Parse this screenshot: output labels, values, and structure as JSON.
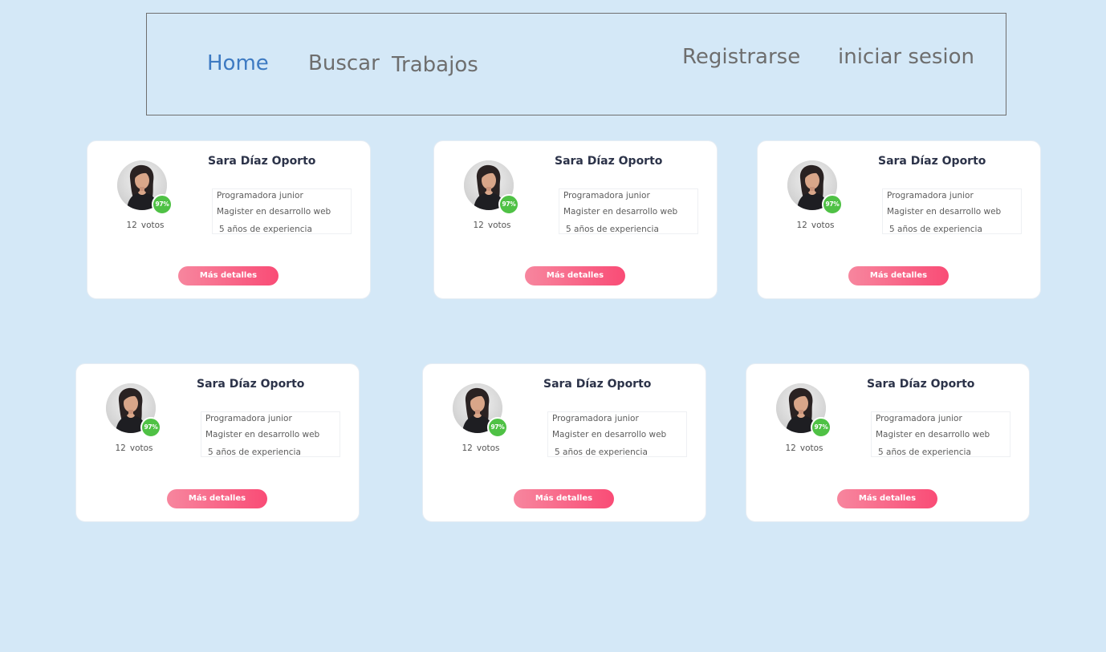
{
  "nav": {
    "home": "Home",
    "search": "Buscar",
    "jobs": "Trabajos",
    "register": "Registrarse",
    "login": "iniciar sesion"
  },
  "colors": {
    "background": "#d4e8f7",
    "nav_active": "#3d7ac2",
    "nav_text": "#6e6e6e",
    "badge": "#4fc145",
    "button_gradient_start": "#f7869e",
    "button_gradient_end": "#f94c76"
  },
  "cards": [
    {
      "name": "Sara Díaz Oporto",
      "rating": "97%",
      "votes_count": "12",
      "votes_label": "votos",
      "role": "Programadora junior",
      "degree": "Magister en desarrollo web",
      "experience": "5 años de experiencia",
      "button": "Más detalles",
      "avatar_icon": "user-photo"
    },
    {
      "name": "Sara Díaz Oporto",
      "rating": "97%",
      "votes_count": "12",
      "votes_label": "votos",
      "role": "Programadora junior",
      "degree": "Magister en desarrollo web",
      "experience": "5 años de experiencia",
      "button": "Más detalles",
      "avatar_icon": "user-photo"
    },
    {
      "name": "Sara Díaz Oporto",
      "rating": "97%",
      "votes_count": "12",
      "votes_label": "votos",
      "role": "Programadora junior",
      "degree": "Magister en desarrollo web",
      "experience": "5 años de experiencia",
      "button": "Más detalles",
      "avatar_icon": "user-photo"
    },
    {
      "name": "Sara Díaz Oporto",
      "rating": "97%",
      "votes_count": "12",
      "votes_label": "votos",
      "role": "Programadora junior",
      "degree": "Magister en desarrollo web",
      "experience": "5 años de experiencia",
      "button": "Más detalles",
      "avatar_icon": "user-photo"
    },
    {
      "name": "Sara Díaz Oporto",
      "rating": "97%",
      "votes_count": "12",
      "votes_label": "votos",
      "role": "Programadora junior",
      "degree": "Magister en desarrollo web",
      "experience": "5 años de experiencia",
      "button": "Más detalles",
      "avatar_icon": "user-photo"
    },
    {
      "name": "Sara Díaz Oporto",
      "rating": "97%",
      "votes_count": "12",
      "votes_label": "votos",
      "role": "Programadora junior",
      "degree": "Magister en desarrollo web",
      "experience": "5 años de experiencia",
      "button": "Más detalles",
      "avatar_icon": "user-photo"
    }
  ]
}
